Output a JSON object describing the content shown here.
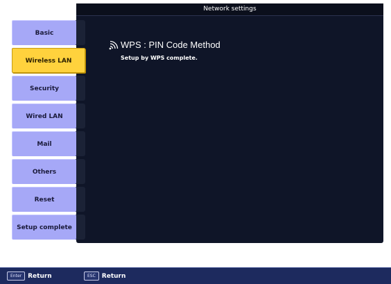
{
  "window": {
    "title": "Network settings"
  },
  "menu": {
    "items": [
      {
        "label": "Basic"
      },
      {
        "label": "Wireless LAN"
      },
      {
        "label": "Security"
      },
      {
        "label": "Wired LAN"
      },
      {
        "label": "Mail"
      },
      {
        "label": "Others"
      },
      {
        "label": "Reset"
      },
      {
        "label": "Setup complete"
      }
    ],
    "active_index": 1
  },
  "content": {
    "icon": "wireless-signal-icon",
    "title": "WPS : PIN Code Method",
    "message": "Setup by WPS complete."
  },
  "footer": {
    "enter_key": "Enter",
    "enter_label": "Return",
    "esc_key": "ESC",
    "esc_label": "Return"
  },
  "colors": {
    "panel_bg": "#0f1528",
    "menu_item": "#a6a8f7",
    "menu_active": "#ffd23d",
    "footer_bg": "#1d2a5e"
  }
}
